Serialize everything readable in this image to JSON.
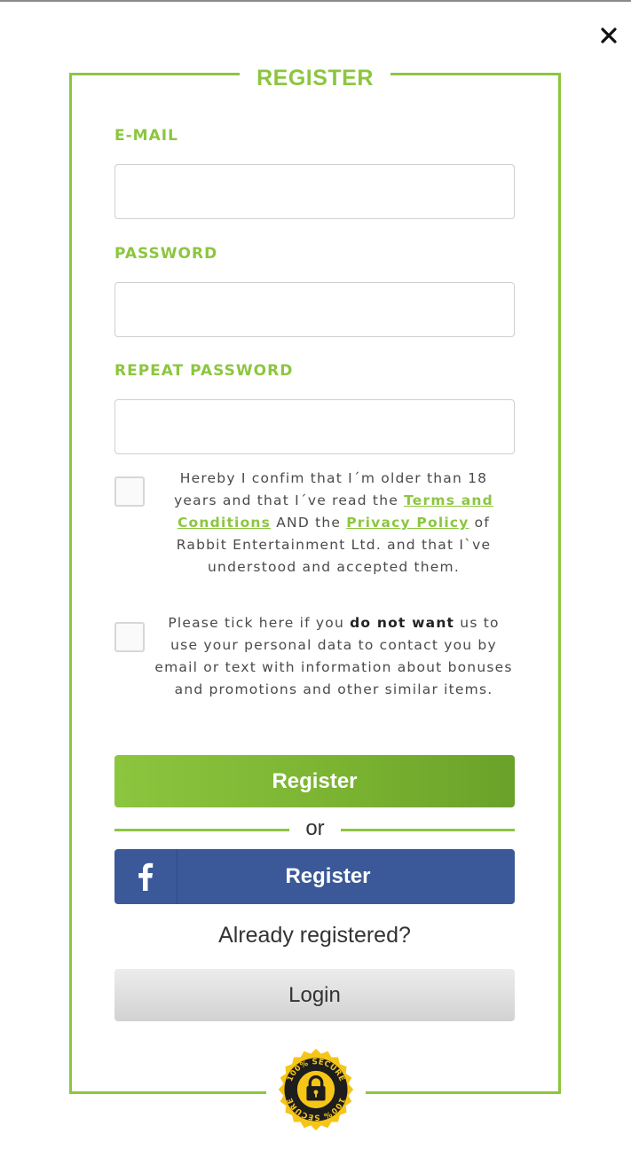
{
  "dialog": {
    "title": "REGISTER",
    "close_label": "Close"
  },
  "form": {
    "email": {
      "label": "E-MAIL",
      "value": "",
      "placeholder": ""
    },
    "password": {
      "label": "PASSWORD",
      "value": "",
      "placeholder": ""
    },
    "repeat_password": {
      "label": "REPEAT PASSWORD",
      "value": "",
      "placeholder": ""
    }
  },
  "consent_terms": {
    "checked": false,
    "text_before": "Hereby I confim that I´m older than 18 years and that I´ve read the ",
    "terms_link": "Terms and Conditions",
    "text_and": " AND the ",
    "privacy_link": "Privacy Policy",
    "text_after": " of Rabbit Entertainment Ltd. and that I`ve understood and accepted them."
  },
  "consent_marketing": {
    "checked": false,
    "text_before": "Please tick here if you ",
    "emphasis": "do not want",
    "text_after": " us to use your personal data to contact you by email or text with information about bonuses and promotions and other similar items."
  },
  "buttons": {
    "register": "Register",
    "or": "or",
    "facebook_register": "Register",
    "already_registered": "Already registered?",
    "login": "Login"
  },
  "badge": {
    "top_text": "100% SECURE",
    "bottom_text": "100% SECURE"
  },
  "colors": {
    "accent_green": "#8cc63f",
    "facebook_blue": "#3b5998",
    "badge_gold": "#f5c518"
  },
  "icons": [
    "close-icon",
    "facebook-icon",
    "lock-icon"
  ]
}
